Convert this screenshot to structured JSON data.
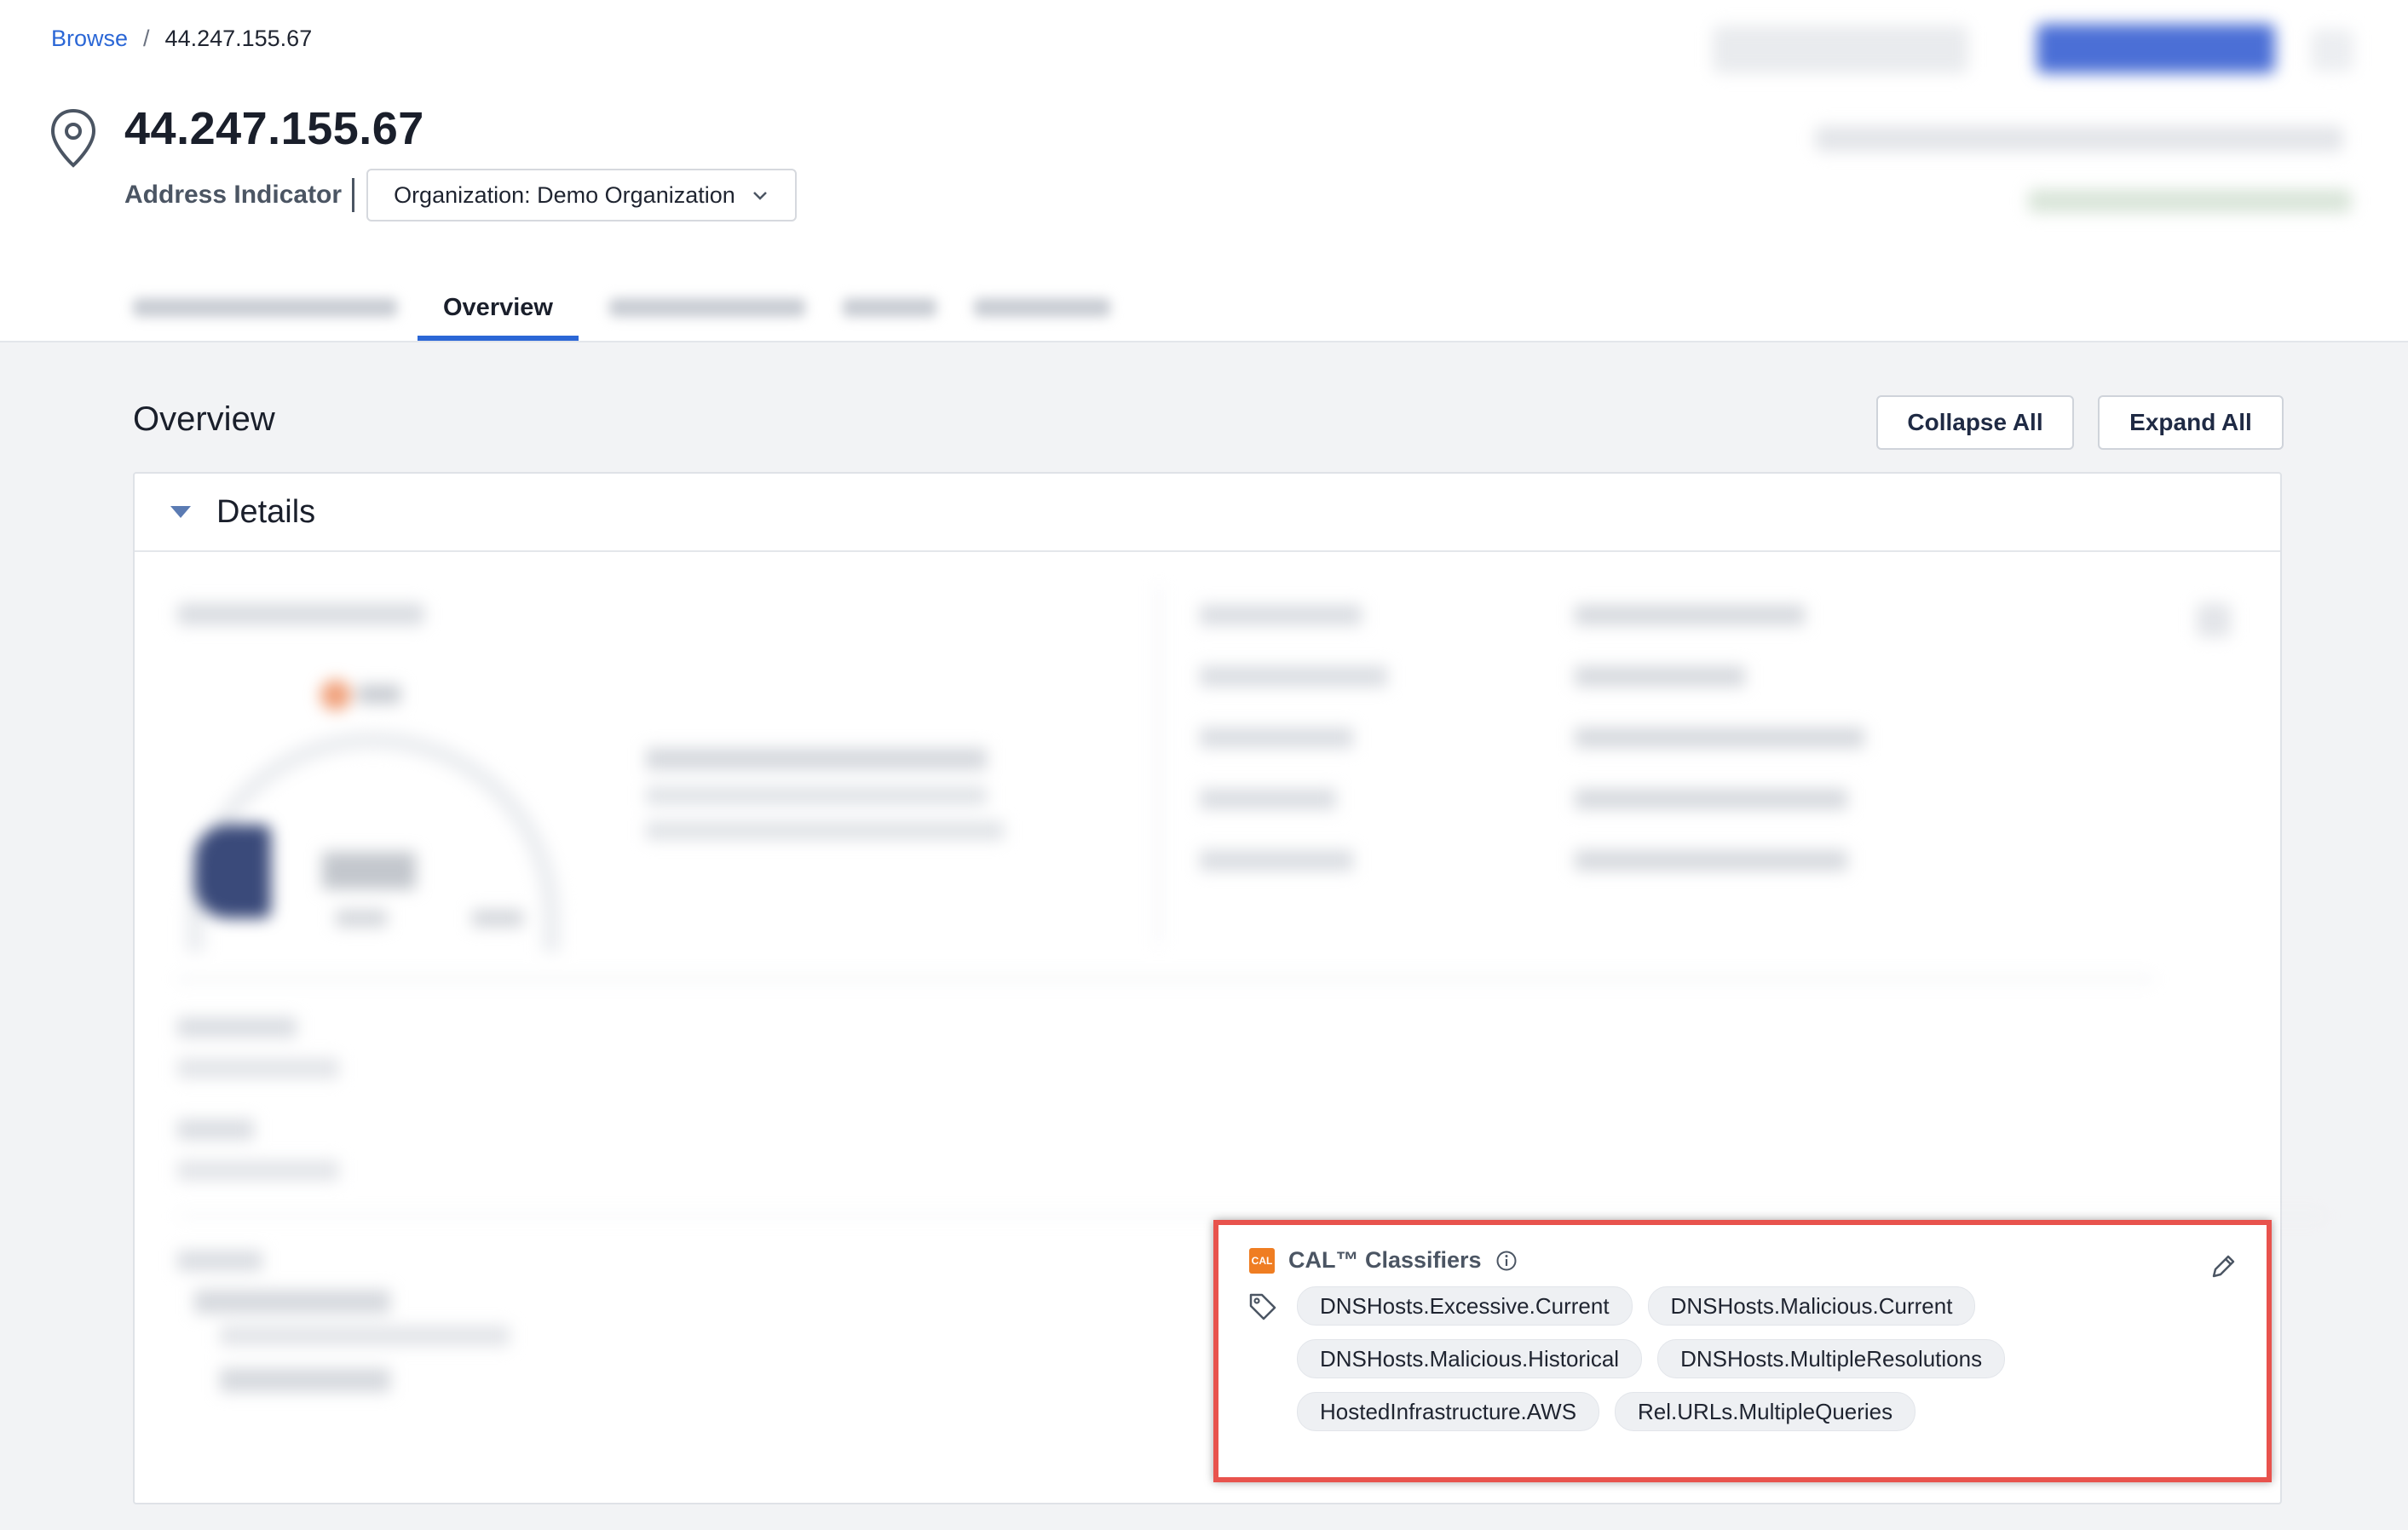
{
  "breadcrumb": {
    "link": "Browse",
    "separator": "/",
    "current": "44.247.155.67"
  },
  "header": {
    "title": "44.247.155.67",
    "type_label": "Address Indicator",
    "org_select": "Organization: Demo Organization"
  },
  "tabs": [
    {
      "label": "Overview",
      "active": true
    }
  ],
  "section": {
    "title": "Overview",
    "collapse_label": "Collapse All",
    "expand_label": "Expand All"
  },
  "details": {
    "header": "Details",
    "cal": {
      "logo_text": "CAL",
      "title": "CAL™ Classifiers",
      "tags": [
        "DNSHosts.Excessive.Current",
        "DNSHosts.Malicious.Current",
        "DNSHosts.Malicious.Historical",
        "DNSHosts.MultipleResolutions",
        "HostedInfrastructure.AWS",
        "Rel.URLs.MultipleQueries"
      ]
    }
  },
  "colors": {
    "accent": "#2b67d6",
    "highlight_border": "#e8534d",
    "cal_logo": "#ef7d22"
  },
  "icons": [
    "location-pin-icon",
    "chevron-down-icon",
    "caret-down-icon",
    "info-icon",
    "tag-icon",
    "pencil-icon"
  ]
}
